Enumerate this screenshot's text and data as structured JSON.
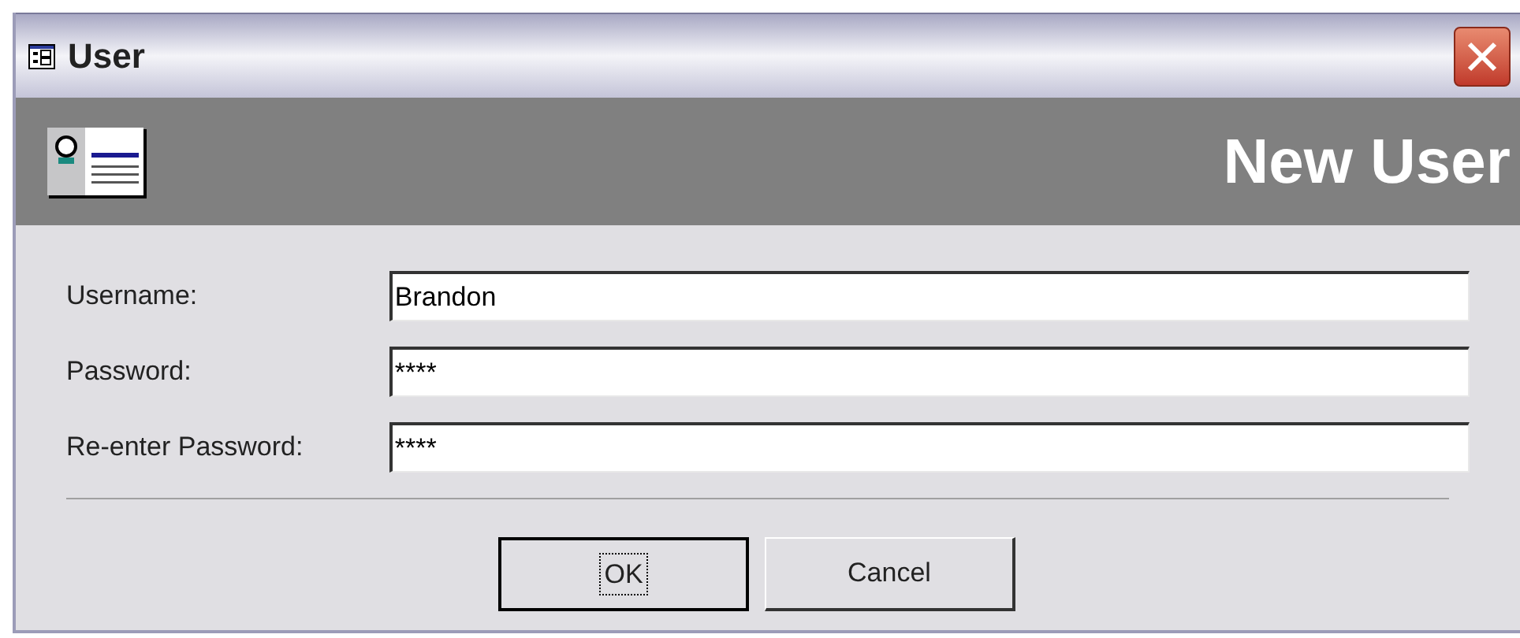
{
  "window": {
    "title": "User"
  },
  "header": {
    "title": "New User"
  },
  "fields": [
    {
      "label": "Username:",
      "value": "Brandon"
    },
    {
      "label": "Password:",
      "value": "****"
    },
    {
      "label": "Re-enter Password:",
      "value": "****"
    }
  ],
  "buttons": [
    {
      "label": "OK",
      "default": true
    },
    {
      "label": "Cancel",
      "default": false
    }
  ]
}
